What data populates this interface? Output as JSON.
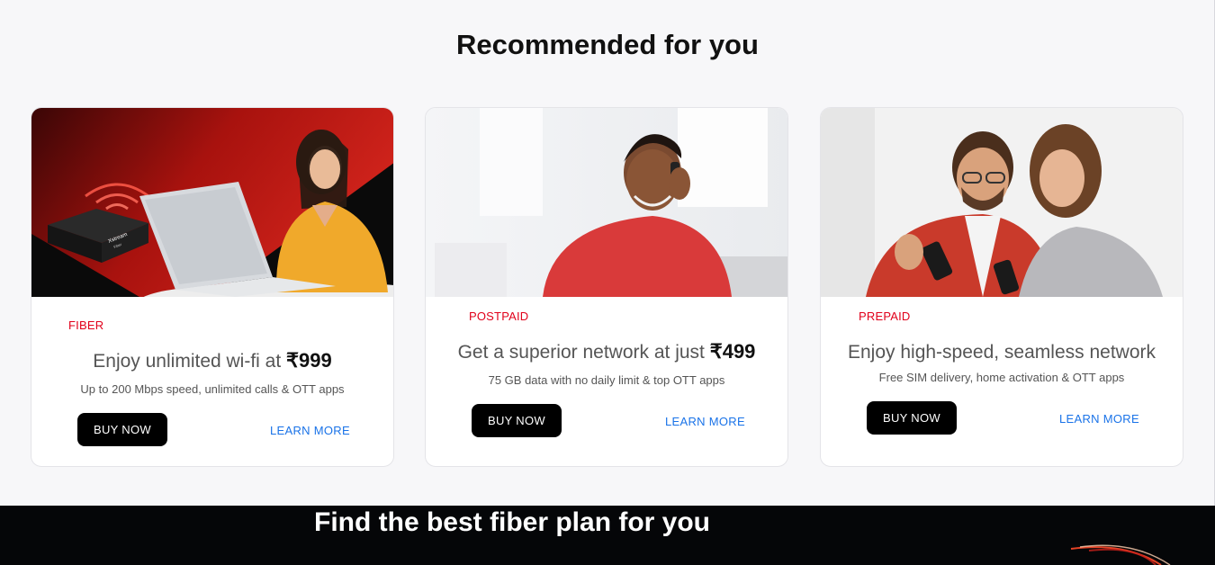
{
  "section": {
    "title": "Recommended for you"
  },
  "cards": [
    {
      "tag": "FIBER",
      "title_prefix": "Enjoy unlimited wi-fi at ",
      "title_price": "₹999",
      "description": "Up to 200 Mbps speed, unlimited calls & OTT apps",
      "buy_label": "BUY NOW",
      "learn_label": "LEARN MORE",
      "router_brand": "Xstream",
      "router_sub": "Fiber"
    },
    {
      "tag": "POSTPAID",
      "title_prefix": "Get a superior network at just ",
      "title_price": "₹499",
      "description": "75 GB data with no daily limit & top OTT apps",
      "buy_label": "BUY NOW",
      "learn_label": "LEARN MORE"
    },
    {
      "tag": "PREPAID",
      "title_prefix": "Enjoy high-speed, seamless network",
      "title_price": "",
      "description": "Free SIM delivery, home activation & OTT apps",
      "buy_label": "BUY NOW",
      "learn_label": "LEARN MORE"
    }
  ],
  "banner": {
    "title": "Find the best fiber plan for you"
  },
  "colors": {
    "accent": "#e1001a",
    "link": "#1a73e8",
    "button": "#000000"
  }
}
